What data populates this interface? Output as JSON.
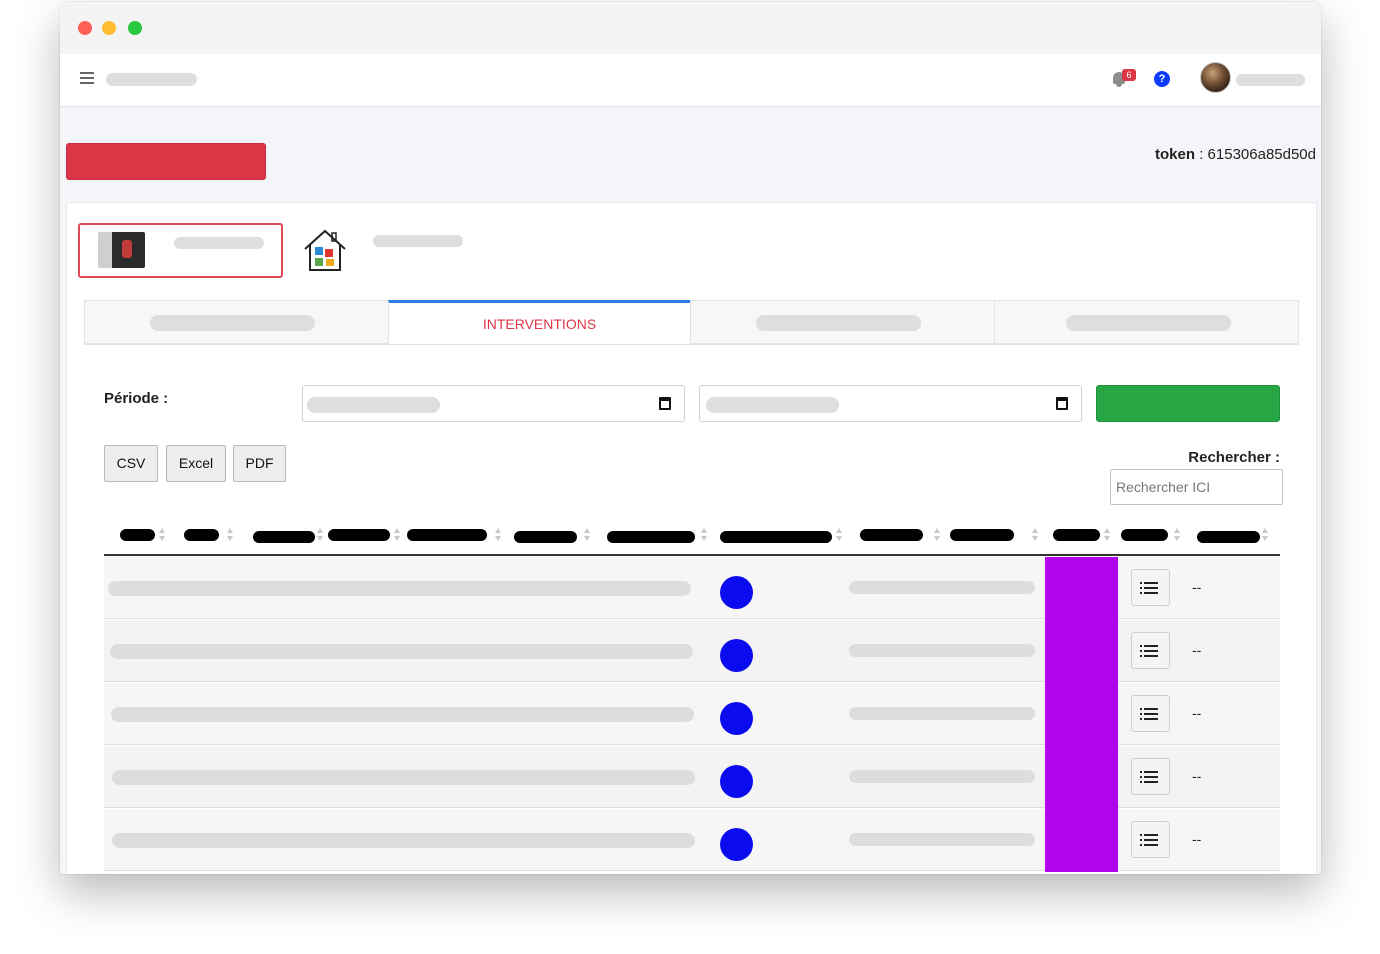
{
  "window": {
    "traffic_lights": [
      "close",
      "minimize",
      "zoom"
    ]
  },
  "topnav": {
    "menu_icon": "hamburger-icon",
    "notification_count": "6",
    "help_glyph": "?"
  },
  "token": {
    "label": "token",
    "separator": " : ",
    "value": "615306a85d50d"
  },
  "tabs": [
    {
      "label": ""
    },
    {
      "label": "INTERVENTIONS",
      "active": true
    },
    {
      "label": ""
    },
    {
      "label": ""
    }
  ],
  "filters": {
    "periode_label": "Période :",
    "search_label": "Rechercher :",
    "search_placeholder": "Rechercher ICI"
  },
  "export_buttons": {
    "csv": "CSV",
    "excel": "Excel",
    "pdf": "PDF"
  },
  "table": {
    "rows": [
      {
        "last_cell": "--"
      },
      {
        "last_cell": "--"
      },
      {
        "last_cell": "--"
      },
      {
        "last_cell": "--"
      },
      {
        "last_cell": "--"
      }
    ]
  },
  "colors": {
    "accent_red": "#dc3545",
    "accent_green": "#28a745",
    "status_blue": "#0b0bf0",
    "status_purple": "#b005ea",
    "tab_active_border": "#2a7de1"
  }
}
